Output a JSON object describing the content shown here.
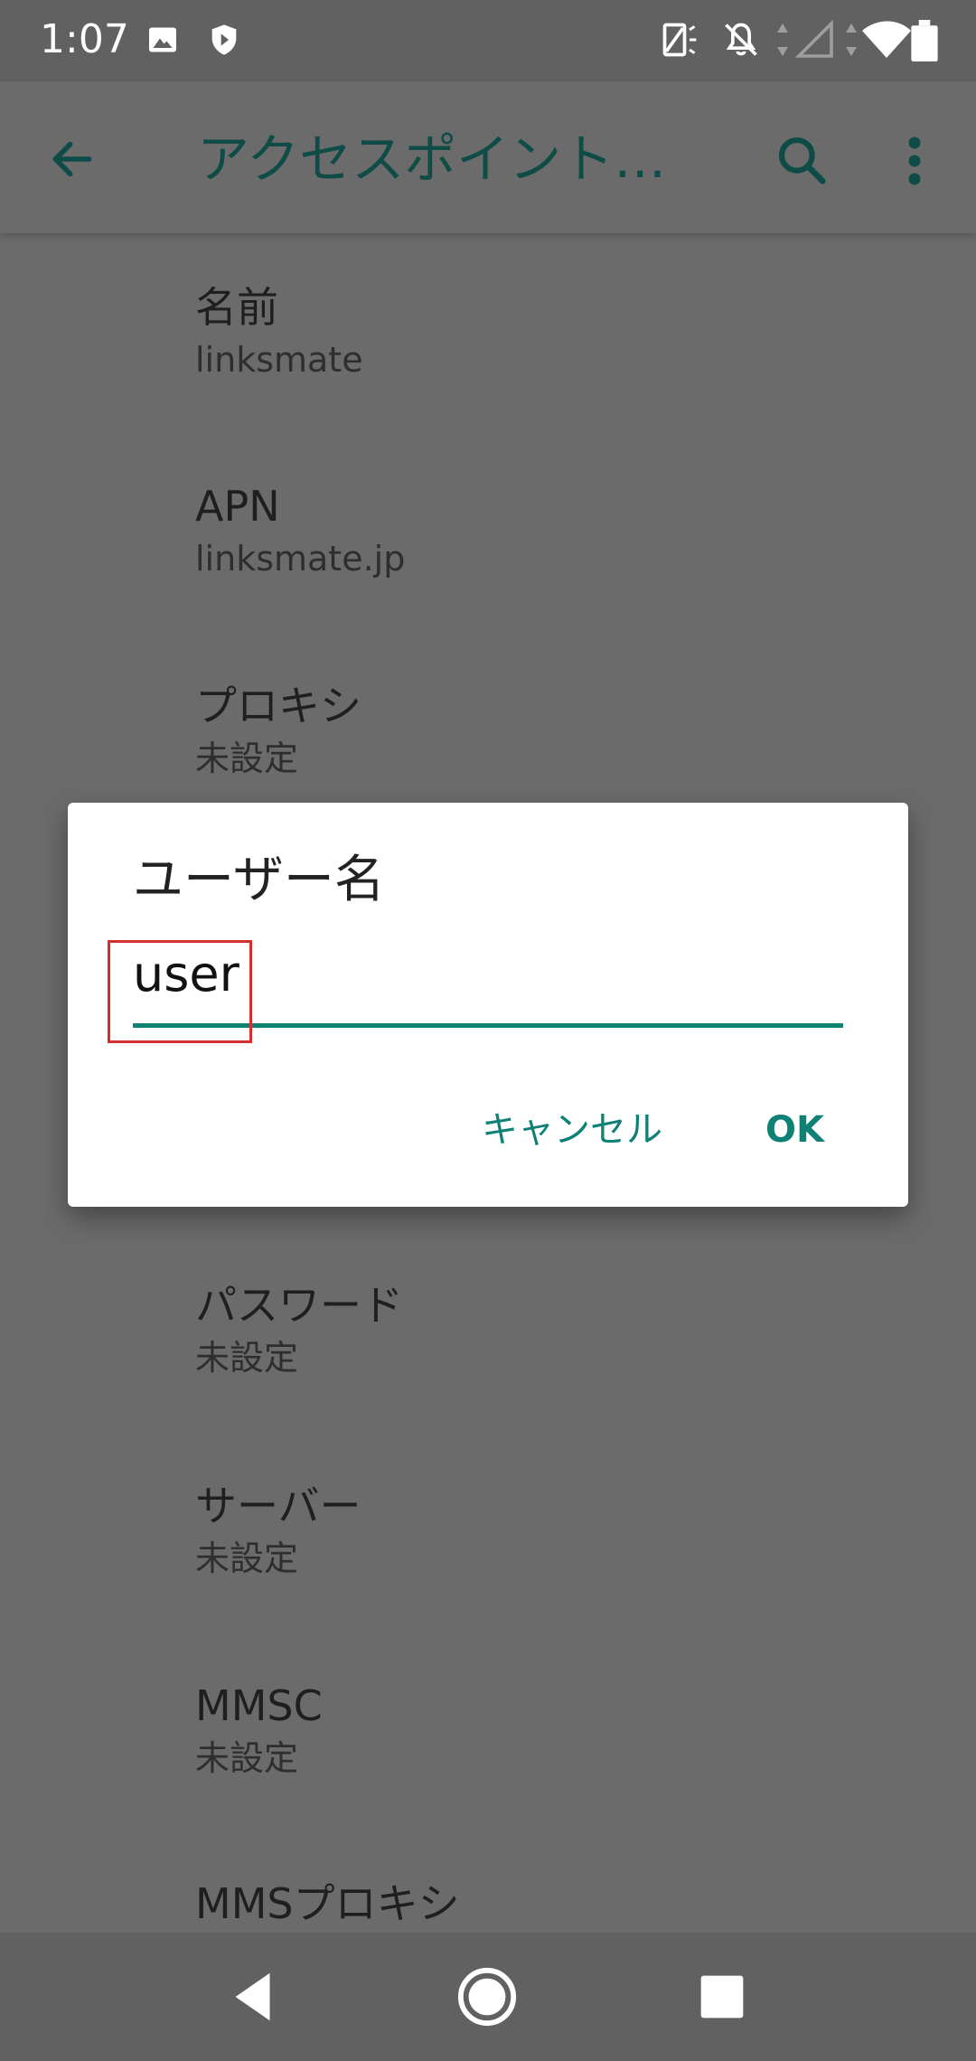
{
  "status_bar": {
    "time": "1:07"
  },
  "app_bar": {
    "title": "アクセスポイント…",
    "back_icon": "arrow-left-icon",
    "search_icon": "search-icon",
    "more_icon": "more-vert-icon"
  },
  "preferences": [
    {
      "title": "名前",
      "summary": "linksmate"
    },
    {
      "title": "APN",
      "summary": "linksmate.jp"
    },
    {
      "title": "プロキシ",
      "summary": "未設定"
    },
    {
      "title": "パスワード",
      "summary": "未設定"
    },
    {
      "title": "サーバー",
      "summary": "未設定"
    },
    {
      "title": "MMSC",
      "summary": "未設定"
    },
    {
      "title": "MMSプロキシ",
      "summary": ""
    }
  ],
  "dialog": {
    "title": "ユーザー名",
    "input_value": "user",
    "cancel_label": "キャンセル",
    "ok_label": "OK"
  },
  "colors": {
    "accent": "#0e8175",
    "scrim": "#6b6b6b",
    "highlight": "#d32f2f"
  }
}
